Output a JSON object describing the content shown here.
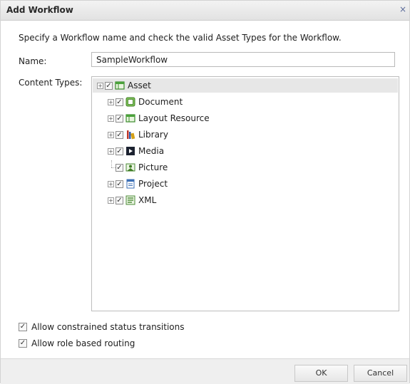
{
  "dialog": {
    "title": "Add Workflow",
    "close_glyph": "×",
    "instruction": "Specify a Workflow name and check the valid Asset Types for the Workflow.",
    "name_label": "Name:",
    "name_value": "SampleWorkflow",
    "content_types_label": "Content Types:"
  },
  "tree": {
    "root": {
      "label": "Asset",
      "checked": true,
      "icon": "asset-icon"
    },
    "items": [
      {
        "label": "Document",
        "checked": true,
        "icon": "document-icon",
        "has_children": true
      },
      {
        "label": "Layout Resource",
        "checked": true,
        "icon": "layout-resource-icon",
        "has_children": true
      },
      {
        "label": "Library",
        "checked": true,
        "icon": "library-icon",
        "has_children": true
      },
      {
        "label": "Media",
        "checked": true,
        "icon": "media-icon",
        "has_children": true
      },
      {
        "label": "Picture",
        "checked": true,
        "icon": "picture-icon",
        "has_children": false
      },
      {
        "label": "Project",
        "checked": true,
        "icon": "project-icon",
        "has_children": true
      },
      {
        "label": "XML",
        "checked": true,
        "icon": "xml-icon",
        "has_children": true
      }
    ]
  },
  "options": {
    "constrained_label": "Allow constrained status transitions",
    "constrained_checked": true,
    "role_label": "Allow role based routing",
    "role_checked": true
  },
  "buttons": {
    "ok": "OK",
    "cancel": "Cancel"
  },
  "symbols": {
    "check": "✓",
    "expand": "+"
  },
  "colors": {
    "titlebar": "#e6e6e6",
    "tree_root_highlight": "#e7e7e7",
    "footer": "#efefef"
  }
}
